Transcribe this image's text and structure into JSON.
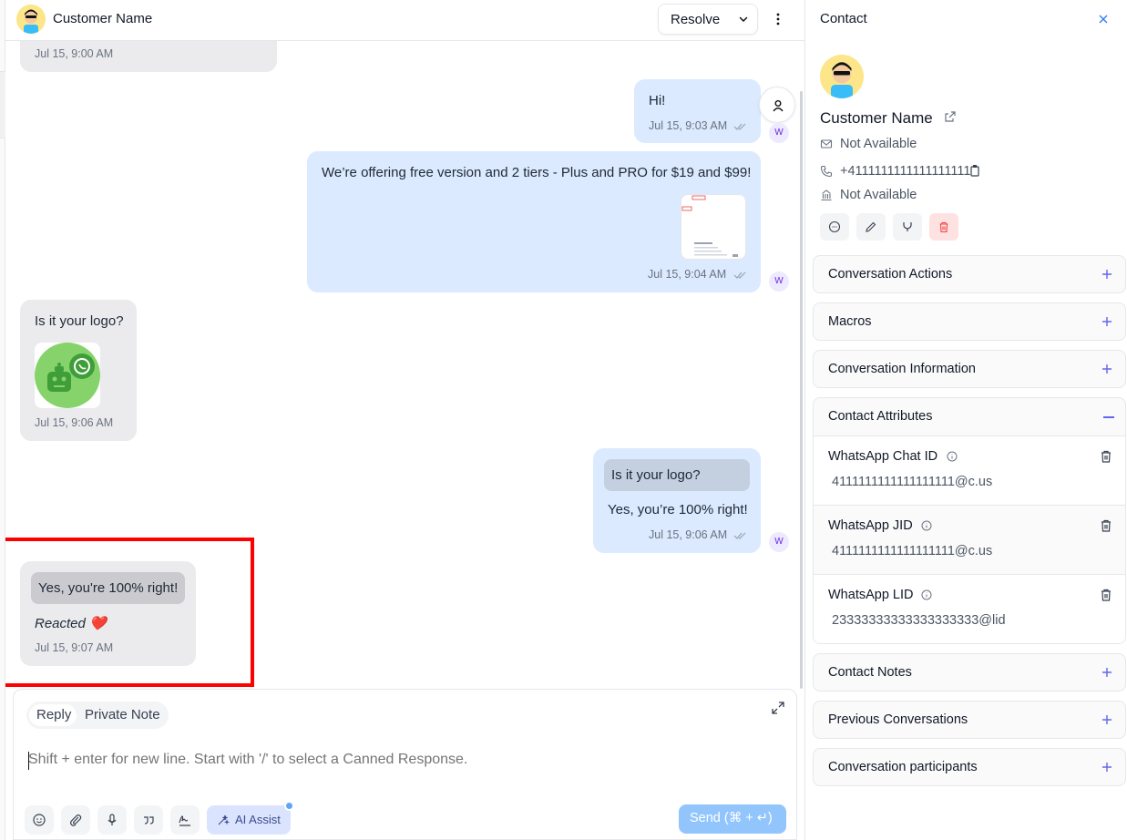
{
  "header": {
    "contact_name": "Customer Name",
    "resolve_label": "Resolve"
  },
  "messages": {
    "m0_time": "Jul 15, 9:00 AM",
    "m1_text": "Hi!",
    "m1_time": "Jul 15, 9:03 AM",
    "m2_text": "We’re offering free version and 2 tiers - Plus and PRO for $19 and $99!",
    "m2_time": "Jul 15, 9:04 AM",
    "m3_text": "Is it your logo?",
    "m3_time": "Jul 15, 9:06 AM",
    "m4_quote": "Is it your logo?",
    "m4_text": "Yes, you’re 100% right!",
    "m4_time": "Jul 15, 9:06 AM",
    "m5_quote": "Yes, you're 100% right!",
    "m5_text": "Reacted ❤️",
    "m5_time": "Jul 15, 9:07 AM",
    "agent_initial": "W"
  },
  "composer": {
    "tab_reply": "Reply",
    "tab_private": "Private Note",
    "placeholder": "Shift + enter for new line. Start with '/' to select a Canned Response.",
    "ai_assist": "AI Assist",
    "send_label": "Send (⌘ + ↵)"
  },
  "panel": {
    "title": "Contact",
    "name": "Customer Name",
    "email": "Not Available",
    "phone": "+4111111111111111111",
    "company": "Not Available",
    "sections": {
      "conversation_actions": "Conversation Actions",
      "macros": "Macros",
      "conversation_information": "Conversation Information",
      "contact_attributes": "Contact Attributes",
      "contact_notes": "Contact Notes",
      "previous_conversations": "Previous Conversations",
      "conversation_participants": "Conversation participants"
    },
    "attributes": [
      {
        "label": "WhatsApp Chat ID",
        "value": "4111111111111111111@c.us"
      },
      {
        "label": "WhatsApp JID",
        "value": "4111111111111111111@c.us"
      },
      {
        "label": "WhatsApp LID",
        "value": "23333333333333333333@lid"
      }
    ]
  },
  "icons": {
    "ticks": "double-check-icon",
    "assign": "user-icon",
    "close": "x-icon",
    "external": "external-link-icon",
    "mail": "mail-icon",
    "phone": "phone-icon",
    "company": "building-icon",
    "delete": "trash-icon",
    "info": "info-icon"
  },
  "colors": {
    "incoming_bubble": "#ebebee",
    "outgoing_bubble": "#dbeafe",
    "accent": "#6366f1",
    "highlight": "#ff0000",
    "send_button": "#93c5fd"
  }
}
